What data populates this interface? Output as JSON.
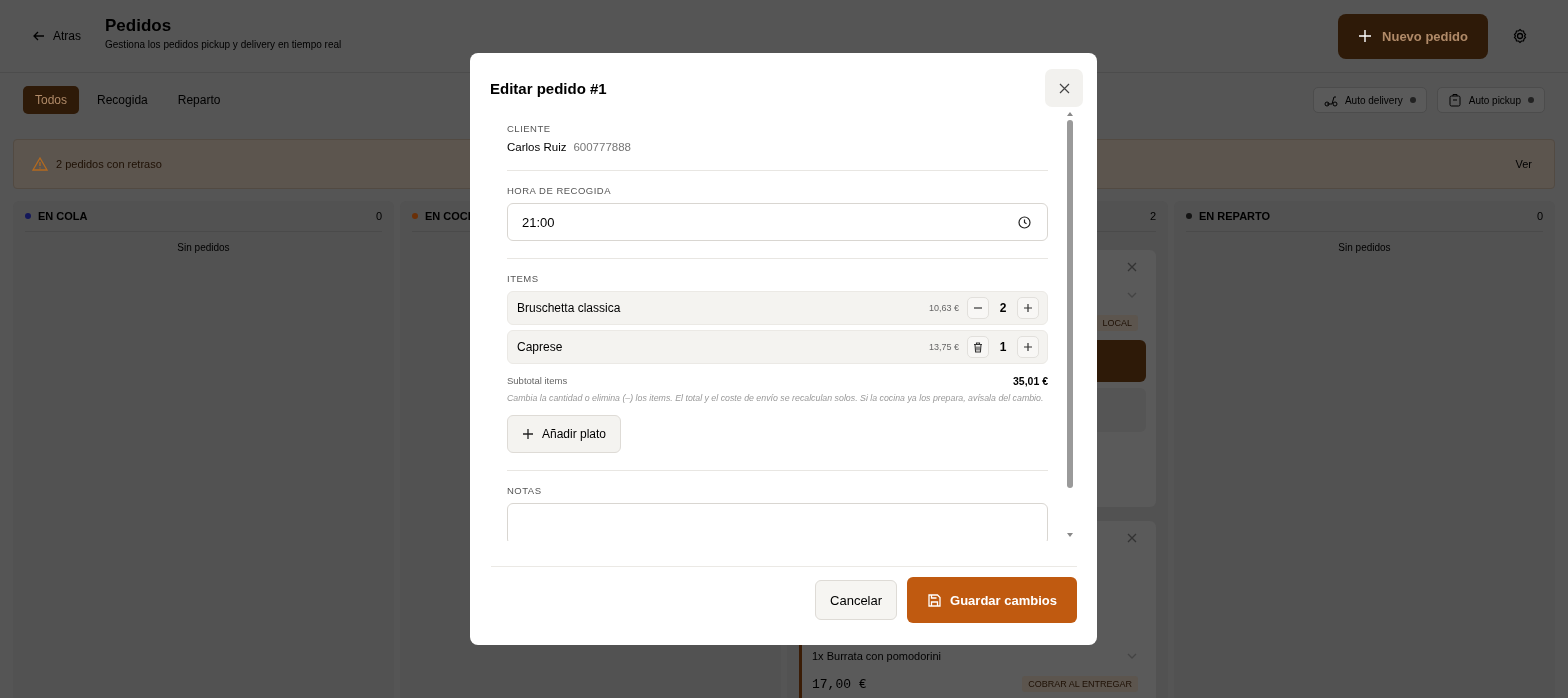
{
  "header": {
    "back": "Atras",
    "title": "Pedidos",
    "subtitle": "Gestiona los pedidos pickup y delivery en tiempo real",
    "new_order": "Nuevo pedido"
  },
  "filters": [
    {
      "label": "Todos",
      "selected": true
    },
    {
      "label": "Recogida",
      "selected": false
    },
    {
      "label": "Reparto",
      "selected": false
    }
  ],
  "toggles": [
    {
      "label": "Auto delivery",
      "kind": "delivery",
      "on": false
    },
    {
      "label": "Auto pickup",
      "kind": "pickup",
      "on": false
    }
  ],
  "alert": {
    "text": "2 pedidos con retraso",
    "action": "Ver"
  },
  "columns": [
    {
      "title": "EN COLA",
      "count": "0",
      "color": "#14185a",
      "empty": "Sin pedidos"
    },
    {
      "title": "EN COCI",
      "color": "#6a3008"
    },
    {
      "count": "2",
      "cards": [
        {
          "tag": "LOCAL"
        },
        {
          "line": "1x Burrata con pomodorini",
          "price": "17,00 €",
          "tag": "COBRAR AL ENTREGAR"
        }
      ]
    },
    {
      "title": "EN REPARTO",
      "count": "0",
      "color": "#141414",
      "empty": "Sin pedidos"
    }
  ],
  "modal": {
    "title": "Editar pedido #1",
    "client_label": "CLIENTE",
    "client_name": "Carlos Ruiz",
    "client_phone": "600777888",
    "time_label": "HORA DE RECOGIDA",
    "time_value": "21:00",
    "items_label": "ITEMS",
    "items": [
      {
        "name": "Bruschetta classica",
        "price": "10,63 €",
        "qty": "2",
        "kind": "minus"
      },
      {
        "name": "Caprese",
        "price": "13,75 €",
        "qty": "1",
        "kind": "trash"
      }
    ],
    "subtotal_label": "Subtotal items",
    "subtotal": "35,01 €",
    "hint": "Cambia la cantidad o elimina (–) los items. El total y el coste de envío se recalculan solos. Si la cocina ya los prepara, avísala del cambio.",
    "add": "Añadir plato",
    "notes_label": "NOTAS",
    "cancel": "Cancelar",
    "save": "Guardar cambios"
  }
}
